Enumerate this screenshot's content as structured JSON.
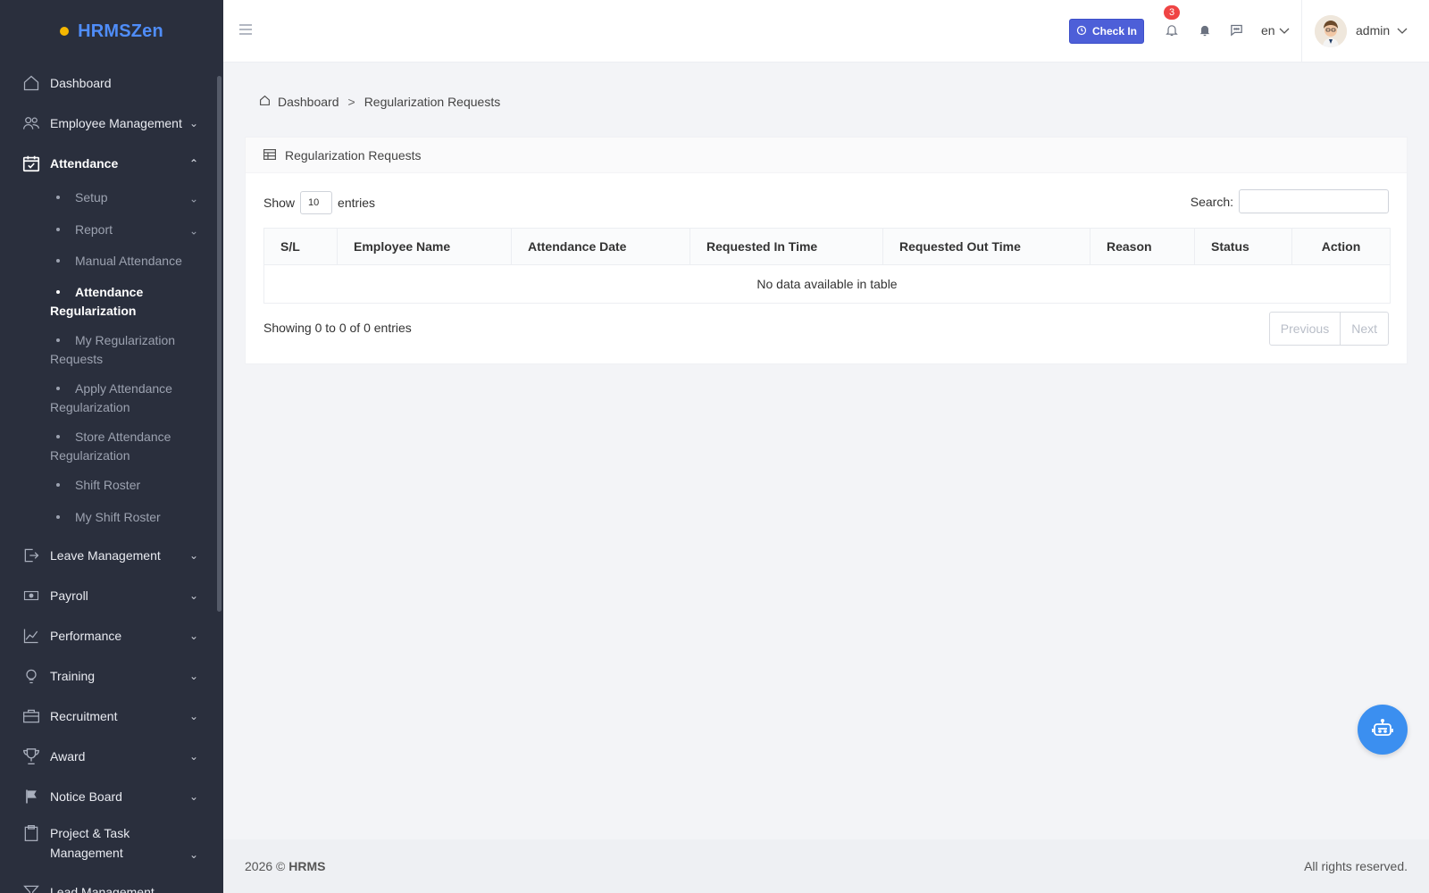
{
  "brand": {
    "name": "HRMSZen"
  },
  "sidebar": {
    "items": [
      {
        "label": "Dashboard",
        "icon": "home-icon"
      },
      {
        "label": "Employee Management",
        "icon": "users-icon"
      },
      {
        "label": "Attendance",
        "icon": "calendar-check-icon"
      },
      {
        "label": "Leave Management",
        "icon": "exit-icon"
      },
      {
        "label": "Payroll",
        "icon": "money-icon"
      },
      {
        "label": "Performance",
        "icon": "chart-line-icon"
      },
      {
        "label": "Training",
        "icon": "lightbulb-icon"
      },
      {
        "label": "Recruitment",
        "icon": "briefcase-icon"
      },
      {
        "label": "Award",
        "icon": "trophy-icon"
      },
      {
        "label": "Notice Board",
        "icon": "flag-icon"
      },
      {
        "label": "Project & Task Management",
        "icon": "clipboard-icon"
      },
      {
        "label": "Lead Management",
        "icon": "funnel-icon"
      }
    ],
    "attendance_sub": [
      {
        "label": "Setup"
      },
      {
        "label": "Report"
      },
      {
        "label": "Manual Attendance"
      },
      {
        "label": "Attendance Regularization"
      },
      {
        "label": "My Regularization Requests"
      },
      {
        "label": "Apply Attendance Regularization"
      },
      {
        "label": "Store Attendance Regularization"
      },
      {
        "label": "Shift Roster"
      },
      {
        "label": "My Shift Roster"
      }
    ]
  },
  "header": {
    "checkin_label": "Check In",
    "notification_count": "3",
    "language": "en",
    "user_name": "admin"
  },
  "breadcrumb": {
    "home": "Dashboard",
    "separator": ">",
    "current": "Regularization Requests"
  },
  "card": {
    "title": "Regularization Requests",
    "show_label": "Show",
    "show_value": "10",
    "entries_label": "entries",
    "search_label": "Search:",
    "columns": [
      "S/L",
      "Employee Name",
      "Attendance Date",
      "Requested In Time",
      "Requested Out Time",
      "Reason",
      "Status",
      "Action"
    ],
    "empty_message": "No data available in table",
    "info": "Showing 0 to 0 of 0 entries",
    "prev_label": "Previous",
    "next_label": "Next"
  },
  "footer": {
    "year": "2026 ©",
    "brand": "HRMS",
    "rights": "All rights reserved."
  },
  "colors": {
    "sidebar_bg": "#2a2f3d",
    "brand": "#4f8df9",
    "primary": "#4d5fd8",
    "badge": "#ef4444",
    "fab": "#3b8ff0"
  }
}
